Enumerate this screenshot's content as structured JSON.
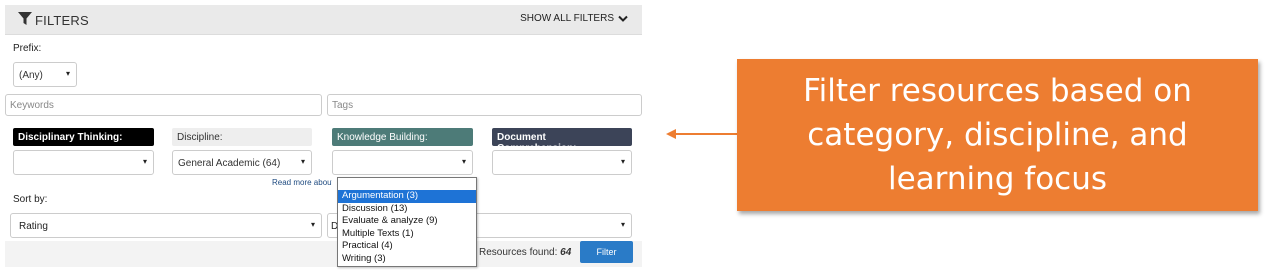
{
  "filters": {
    "title": "FILTERS",
    "show_all": "SHOW ALL FILTERS",
    "prefix_label": "Prefix:",
    "prefix_value": "(Any)",
    "keywords_placeholder": "Keywords",
    "tags_placeholder": "Tags",
    "categories": [
      {
        "label": "Disciplinary Thinking:",
        "value": ""
      },
      {
        "label": "Discipline:",
        "value": "General Academic (64)"
      },
      {
        "label": "Knowledge Building:",
        "value": ""
      },
      {
        "label": "Document Comprehension:",
        "value": ""
      }
    ],
    "read_more": "Read more about",
    "sort_label": "Sort by:",
    "sort_value": "Rating",
    "sort_direction_value": "D",
    "found_label": "Resources found:",
    "found_count": "64",
    "filter_button": "Filter"
  },
  "knowledge_dropdown": {
    "options": [
      "Argumentation (3)",
      "Discussion (13)",
      "Evaluate & analyze (9)",
      "Multiple Texts (1)",
      "Practical (4)",
      "Writing (3)"
    ],
    "selected_index": 0
  },
  "callout": {
    "text": "Filter resources based on category, discipline, and learning focus"
  },
  "colors": {
    "callout": "#ed7d31",
    "filter_button": "#2a7bc7",
    "knowledge_label": "#4d7b78",
    "document_label": "#3c4458",
    "dropdown_selected": "#1e73d6"
  }
}
